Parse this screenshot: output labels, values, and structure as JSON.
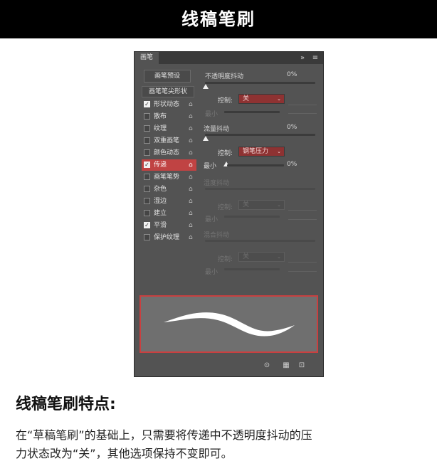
{
  "header": {
    "title": "线稿笔刷"
  },
  "panel": {
    "tab_label": "画笔",
    "collapse_icon": "»",
    "menu_icon": "≡",
    "preset_button": "画笔预设",
    "tip_shape_button": "画笔笔尖形状",
    "options": [
      {
        "label": "形状动态",
        "checked": true,
        "selected": false
      },
      {
        "label": "散布",
        "checked": false,
        "selected": false
      },
      {
        "label": "纹理",
        "checked": false,
        "selected": false
      },
      {
        "label": "双重画笔",
        "checked": false,
        "selected": false
      },
      {
        "label": "颜色动态",
        "checked": false,
        "selected": false
      },
      {
        "label": "传递",
        "checked": true,
        "selected": true
      },
      {
        "label": "画笔笔势",
        "checked": false,
        "selected": false
      },
      {
        "label": "杂色",
        "checked": false,
        "selected": false
      },
      {
        "label": "湿边",
        "checked": false,
        "selected": false
      },
      {
        "label": "建立",
        "checked": false,
        "selected": false
      },
      {
        "label": "平滑",
        "checked": true,
        "selected": false
      },
      {
        "label": "保护纹理",
        "checked": false,
        "selected": false
      }
    ],
    "lock_icon": "🔓",
    "opacity_jitter": {
      "label": "不透明度抖动",
      "value": "0%",
      "control_label": "控制:",
      "control_value": "关",
      "min_label": "最小"
    },
    "flow_jitter": {
      "label": "流量抖动",
      "value": "0%",
      "control_label": "控制:",
      "control_value": "钢笔压力",
      "min_label": "最小",
      "min_value": "0%"
    },
    "wetness_jitter": {
      "label": "湿度抖动",
      "control_label": "控制:",
      "control_value": "关",
      "min_label": "最小"
    },
    "mix_jitter": {
      "label": "混合抖动",
      "control_label": "控制:",
      "control_value": "关",
      "min_label": "最小"
    },
    "footer_icons": [
      "eye-brush-icon",
      "grid-icon",
      "new-preset-icon"
    ]
  },
  "section": {
    "heading": "线稿笔刷特点:",
    "line1": "在“草稿笔刷”的基础上，只需要将传递中不透明度抖动的压",
    "line2": "力状态改为“关”，其他选项保持不变即可。"
  },
  "colors": {
    "highlight": "#c04343",
    "panel_bg": "#535353",
    "header_bg": "#000000"
  }
}
